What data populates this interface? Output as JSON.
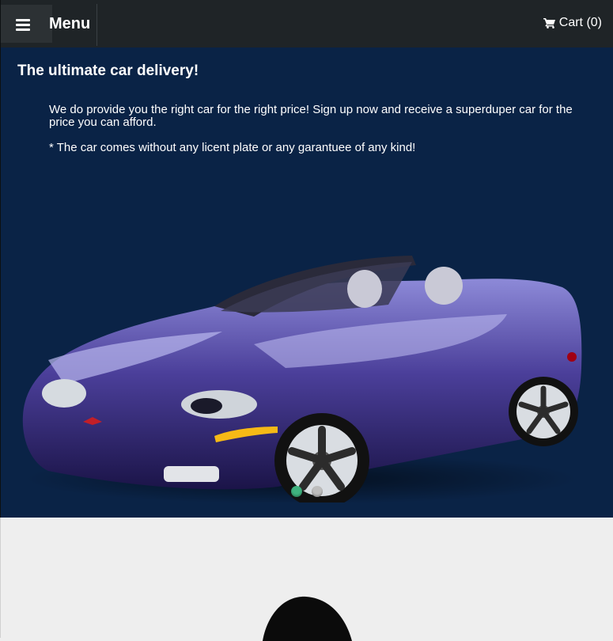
{
  "header": {
    "menu_label": "Menu",
    "cart_label": "Cart (0)"
  },
  "hero": {
    "title": "The ultimate car delivery!",
    "paragraph_1": "We do provide you the right car for the right price! Sign up now and receive a superduper car for the price you can afford.",
    "paragraph_2": "* The car comes without any licent plate or any garantuee of any kind!"
  },
  "carousel": {
    "slide_count": 2,
    "active_index": 0
  },
  "colors": {
    "header_bg": "#1f2427",
    "hero_bg": "#0a2346",
    "accent_dot": "#3fb27f"
  },
  "icons": {
    "menu": "hamburger-icon",
    "cart": "shopping-cart-icon"
  }
}
